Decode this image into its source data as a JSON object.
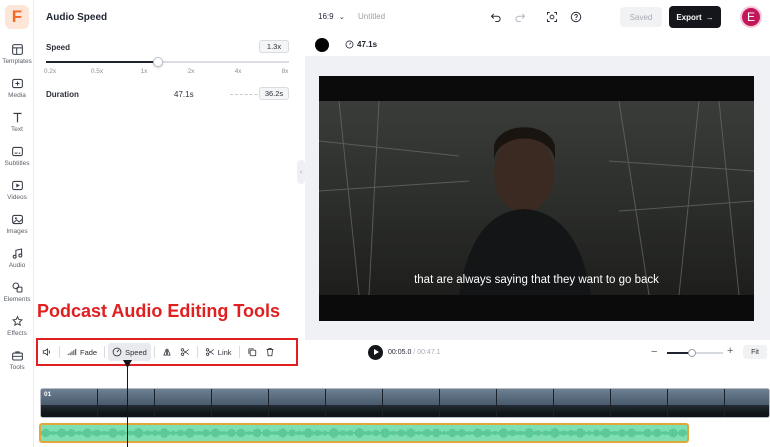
{
  "brand": {
    "logo_letter": "F",
    "accent": "#f26a21"
  },
  "sidebar": {
    "items": [
      {
        "label": "Templates",
        "icon": "templates-icon"
      },
      {
        "label": "Media",
        "icon": "media-icon"
      },
      {
        "label": "Text",
        "icon": "text-icon"
      },
      {
        "label": "Subtitles",
        "icon": "subtitles-icon"
      },
      {
        "label": "Videos",
        "icon": "videos-icon"
      },
      {
        "label": "Images",
        "icon": "images-icon"
      },
      {
        "label": "Audio",
        "icon": "audio-icon"
      },
      {
        "label": "Elements",
        "icon": "elements-icon"
      },
      {
        "label": "Effects",
        "icon": "effects-icon"
      },
      {
        "label": "Tools",
        "icon": "tools-icon"
      }
    ]
  },
  "panel": {
    "title": "Audio Speed",
    "speed_label": "Speed",
    "speed_value": "1.3x",
    "speed_level": 1.3,
    "speed_ticks": [
      "0.2x",
      "0.5x",
      "1x",
      "2x",
      "4x",
      "8x"
    ],
    "duration_label": "Duration",
    "duration_original": "47.1s",
    "duration_new": "36.2s"
  },
  "topbar": {
    "aspect_ratio": "16:9",
    "project_title": "Untitled",
    "saved_label": "Saved",
    "export_label": "Export",
    "avatar_letter": "E",
    "avatar_color": "#c2185b"
  },
  "canvas": {
    "background_color": "#000000",
    "duration_label": "47.1s",
    "subtitle_text": "that are always saying that they want to go back"
  },
  "annotation": {
    "label": "Podcast Audio Editing Tools",
    "color": "#e02020"
  },
  "toolbar": {
    "fade_label": "Fade",
    "speed_label": "Speed",
    "link_label": "Link"
  },
  "playback": {
    "current_time": "00:05.0",
    "separator": " / ",
    "total_time": "00:47.1",
    "zoom_level": 0.45,
    "fit_label": "Fit"
  },
  "timeline": {
    "clip_label": "01",
    "audio_color": "#7ee0b2"
  }
}
